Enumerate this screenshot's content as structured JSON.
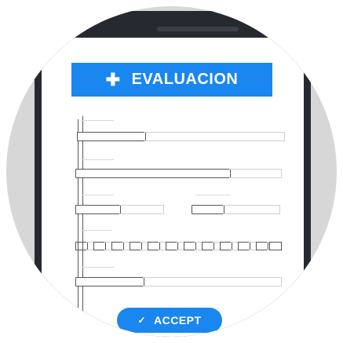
{
  "header": {
    "icon": "plus-icon",
    "label": "EVALUACION",
    "color": "#1a86f0"
  },
  "footer": {
    "icon": "check-icon",
    "accept_label": "ACCEPT",
    "color": "#1a86f0"
  },
  "device": {
    "frame_color": "#262a30",
    "background_color": "#d7d7d7"
  }
}
